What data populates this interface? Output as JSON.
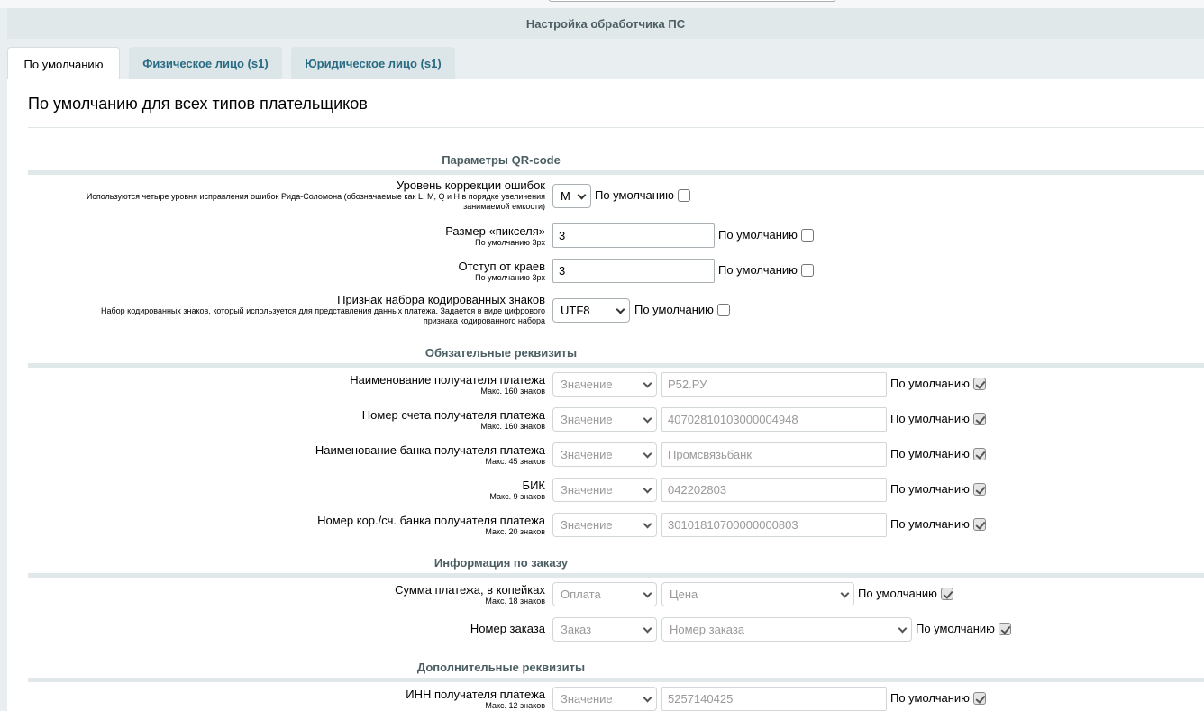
{
  "header": {
    "title": "Настройка обработчика ПС"
  },
  "tabs": [
    {
      "label": "По умолчанию",
      "active": true
    },
    {
      "label": "Физическое лицо (s1)",
      "active": false
    },
    {
      "label": "Юридическое лицо (s1)",
      "active": false
    }
  ],
  "page_title": "По умолчанию для всех типов плательщиков",
  "default_label": "По умолчанию",
  "qr": {
    "section": "Параметры QR-code",
    "error_level": {
      "label": "Уровень коррекции ошибок",
      "hint1": "Используются четыре уровня исправления ошибок Рида-Соломона (обозначаемые как L, M, Q и H в порядке увеличения",
      "hint2": "занимаемой емкости)",
      "value": "M"
    },
    "pixel_size": {
      "label": "Размер «пикселя»",
      "hint": "По умолчанию 3px",
      "value": "3"
    },
    "margin": {
      "label": "Отступ от краев",
      "hint": "По умолчанию 3px",
      "value": "3"
    },
    "charset": {
      "label": "Признак набора кодированных знаков",
      "hint1": "Набор кодированных знаков, который используется для представления данных платежа. Задается в виде цифрового",
      "hint2": "признака кодированного набора",
      "value": "UTF8"
    }
  },
  "required": {
    "section": "Обязательные реквизиты",
    "type_value": "Значение",
    "rows": [
      {
        "label": "Наименование получателя платежа",
        "hint": "Макс. 160 знаков",
        "value": "Р52.РУ"
      },
      {
        "label": "Номер счета получателя платежа",
        "hint": "Макс. 160 знаков",
        "value": "40702810103000004948"
      },
      {
        "label": "Наименование банка получателя платежа",
        "hint": "Макс. 45 знаков",
        "value": "Промсвязьбанк"
      },
      {
        "label": "БИК",
        "hint": "Макс. 9 знаков",
        "value": "042202803"
      },
      {
        "label": "Номер кор./сч. банка получателя платежа",
        "hint": "Макс. 20 знаков",
        "value": "30101810700000000803"
      }
    ]
  },
  "order": {
    "section": "Информация по заказу",
    "sum": {
      "label": "Сумма платежа, в копейках",
      "hint": "Макс. 18 знаков",
      "type": "Оплата",
      "field": "Цена"
    },
    "number": {
      "label": "Номер заказа",
      "type": "Заказ",
      "field": "Номер заказа"
    }
  },
  "additional": {
    "section": "Дополнительные реквизиты",
    "inn": {
      "label": "ИНН получателя платежа",
      "hint": "Макс. 12 знаков",
      "type": "Значение",
      "value": "5257140425"
    }
  }
}
